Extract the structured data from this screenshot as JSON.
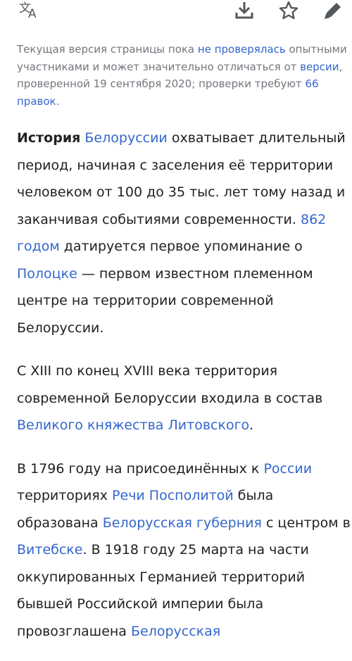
{
  "toolbar": {
    "language_icon": "translate-icon",
    "download_icon": "download-icon",
    "watch_icon": "star-icon",
    "edit_icon": "pencil-icon"
  },
  "notice": {
    "t1": "Текущая версия страницы пока ",
    "link_unreviewed": "не проверялась",
    "t2": " опытными участниками и может значительно отличаться от ",
    "link_version": "версии",
    "t3": ", проверенной 19 сентября 2020; проверки требуют ",
    "link_edits": "66 правок",
    "t4": "."
  },
  "article": {
    "p1": {
      "bold": "История",
      "sp1": " ",
      "link_belarus": "Белоруссии",
      "t1": " охватывает длительный период, начиная с заселения её территории человеком от 100 до 35 тыс. лет тому назад и заканчивая событиями современности. ",
      "link_862": "862 годом",
      "t2": " датируется первое упоминание о ",
      "link_polotsk": "Полоцке",
      "t3": " — первом известном племенном центре на территории современной Белоруссии."
    },
    "p2": {
      "t1": "С XIII по конец XVIII века территория современной Белоруссии входила в состав ",
      "link_gdl": "Великого княжества Литовского",
      "t2": "."
    },
    "p3": {
      "t1": "В 1796 году на присоединённых к ",
      "link_russia": "России",
      "t2": " территориях ",
      "link_commonwealth": "Речи Посполитой",
      "t3": " была образована ",
      "link_governorate": "Белорусская губерния",
      "t4": " с центром в ",
      "link_vitebsk": "Витебске",
      "t5": ". В 1918 году 25 марта на части оккупированных Германией территорий бывшей Российской империи была провозглашена ",
      "link_bnr": "Белорусская"
    }
  },
  "colors": {
    "link": "#3366cc",
    "text": "#202122",
    "muted": "#72777d",
    "icon": "#54595d"
  }
}
